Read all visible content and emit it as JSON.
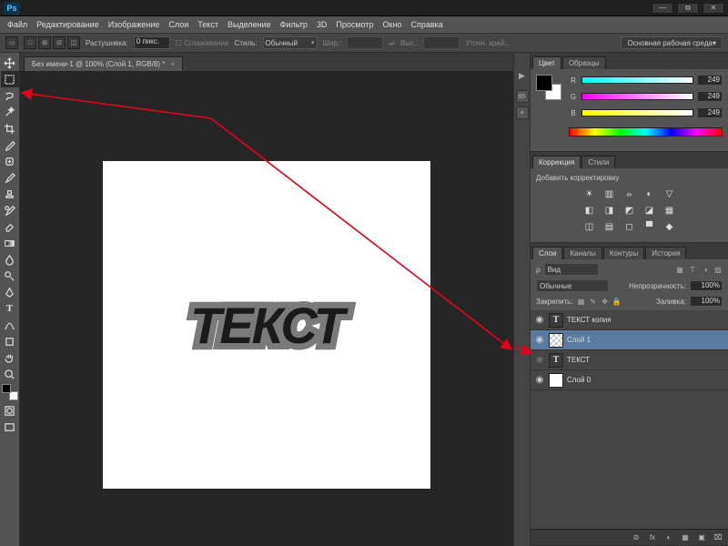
{
  "title_logo": "Ps",
  "window_buttons": {
    "min": "—",
    "restore": "⧉",
    "close": "✕"
  },
  "menu": [
    "Файл",
    "Редактирование",
    "Изображение",
    "Слои",
    "Текст",
    "Выделение",
    "Фильтр",
    "3D",
    "Просмотр",
    "Окно",
    "Справка"
  ],
  "options_bar": {
    "feather_label": "Растушивка:",
    "feather_value": "0 пикс.",
    "antialias_label": "Сглаживание",
    "style_label": "Стиль:",
    "style_value": "Обычный",
    "width_label": "Шир.:",
    "height_label": "Выс.:",
    "link_icon": "⇌",
    "refine_label": "Уточн. край...",
    "workspace": "Основная рабочая среда"
  },
  "document_tab": "Без имени-1 @ 100% (Слой 1, RGB/8) *",
  "canvas_text": "ТЕКСТ",
  "color_panel": {
    "tabs": [
      "Цвет",
      "Образцы"
    ],
    "channels": [
      "R",
      "G",
      "B"
    ],
    "value": "249"
  },
  "adjustments_panel": {
    "tabs": [
      "Коррекция",
      "Стили"
    ],
    "title": "Добавить корректировку"
  },
  "layers_panel": {
    "tabs": [
      "Слои",
      "Каналы",
      "Контуры",
      "История"
    ],
    "kind_icon": "ρ",
    "kind_label": "Вид",
    "filter_icons": [
      "▦",
      "T",
      "◑",
      "▨"
    ],
    "blend_mode": "Обычные",
    "opacity_label": "Непрозрачность:",
    "opacity_value": "100%",
    "lock_label": "Закрепить:",
    "lock_icons": [
      "▦",
      "✎",
      "✥",
      "🔒"
    ],
    "fill_label": "Заливка:",
    "fill_value": "100%",
    "layers": [
      {
        "name": "ТЕКСТ копия",
        "type": "text"
      },
      {
        "name": "Слой 1",
        "type": "raster"
      },
      {
        "name": "ТЕКСТ",
        "type": "text"
      },
      {
        "name": "Слой 0",
        "type": "raster-white"
      }
    ],
    "footer_icons": [
      "⊘",
      "fx",
      "◐",
      "▦",
      "▣",
      "⌧"
    ]
  },
  "dock_icons": [
    "▶",
    "85",
    "≡"
  ]
}
